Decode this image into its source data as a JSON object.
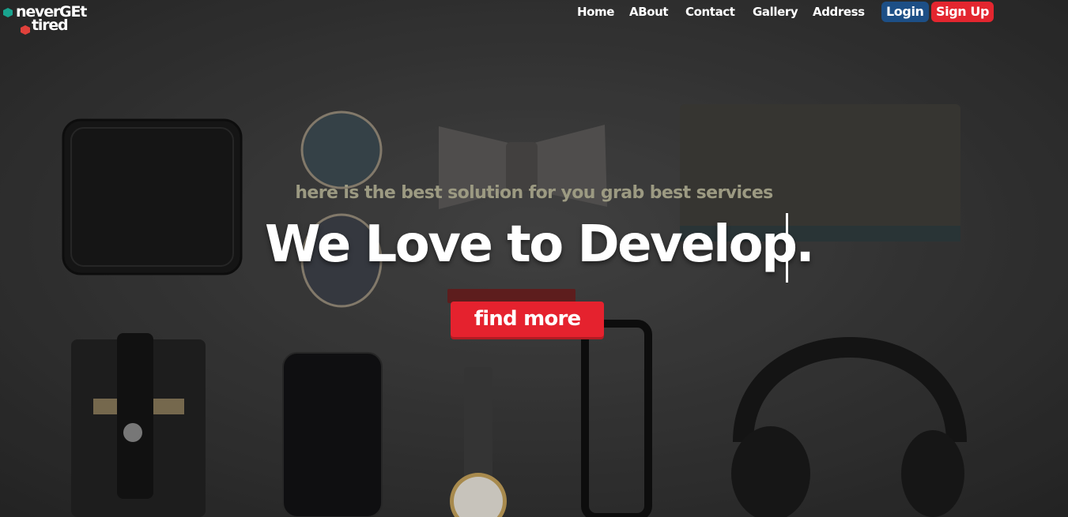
{
  "logo": {
    "line1": "neverGEt",
    "line2": "tired"
  },
  "nav": {
    "items": [
      {
        "label": "Home"
      },
      {
        "label": "ABout"
      },
      {
        "label": "Contact"
      },
      {
        "label": "Gallery"
      },
      {
        "label": "Address"
      }
    ],
    "login_label": "Login",
    "signup_label": "Sign Up"
  },
  "hero": {
    "tagline": "here is the best solution for you grab best services",
    "headline": "We Love to Develop.",
    "cta_label": "find more"
  },
  "colors": {
    "accent_red": "#e5222e",
    "login_blue": "#1d4f86",
    "tagline": "#9c9a82"
  }
}
